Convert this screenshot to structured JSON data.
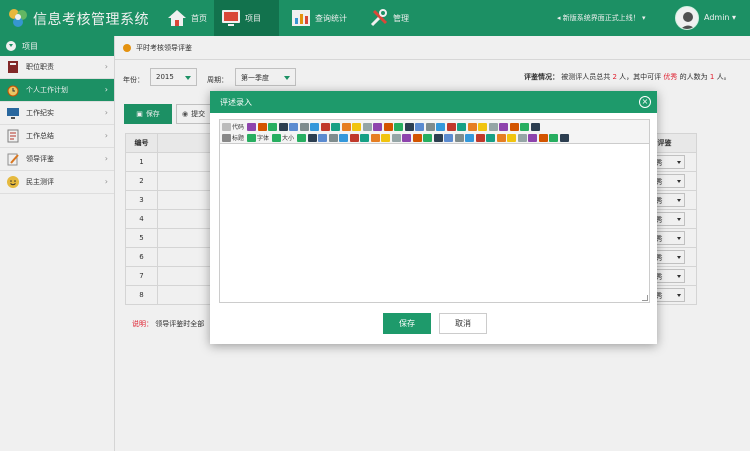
{
  "app": {
    "title": "信息考核管理系统"
  },
  "nav": {
    "home": "首页",
    "project": "项目",
    "stats": "查询统计",
    "manage": "管理"
  },
  "notice": "新版系统界面正式上线！",
  "user": {
    "name": "Admin"
  },
  "sidebar": {
    "header": "项目",
    "items": [
      {
        "label": "职位职责",
        "icon": "book-icon"
      },
      {
        "label": "个人工作计划",
        "icon": "alarm-clock-icon"
      },
      {
        "label": "工作纪实",
        "icon": "monitor-icon"
      },
      {
        "label": "工作总结",
        "icon": "document-icon"
      },
      {
        "label": "领导评鉴",
        "icon": "pen-paper-icon"
      },
      {
        "label": "民主测评",
        "icon": "smiley-icon"
      }
    ]
  },
  "page": {
    "breadcrumb": "平时考核领导评鉴",
    "year_label": "年份：",
    "year_value": "2015",
    "period_label": "周期：",
    "period_value": "第一季度",
    "summary_prefix": "评鉴情况：",
    "summary_text1": "被测评人员总共",
    "summary_total": "2",
    "summary_text2": "人，其中可评",
    "summary_excellent": "优秀",
    "summary_text3": "的人数为",
    "summary_count": "1",
    "summary_text4": "人。",
    "save_label": "保存",
    "submit_label": "提交",
    "note_label": "说明：",
    "note_text": "领导评鉴时全部"
  },
  "table": {
    "headers": {
      "index": "编号",
      "eval": "评鉴"
    },
    "rows": [
      {
        "index": "1",
        "eval": "优秀"
      },
      {
        "index": "2",
        "eval": "优秀"
      },
      {
        "index": "3",
        "eval": "优秀"
      },
      {
        "index": "4",
        "eval": "优秀"
      },
      {
        "index": "5",
        "eval": "优秀"
      },
      {
        "index": "6",
        "eval": "优秀"
      },
      {
        "index": "7",
        "eval": "优秀"
      },
      {
        "index": "8",
        "eval": "优秀"
      }
    ]
  },
  "modal": {
    "title": "评述录入",
    "editor": {
      "code_label": "代码",
      "heading_label": "标题",
      "font_label": "字体",
      "size_label": "大小"
    },
    "save_label": "保存",
    "cancel_label": "取消"
  },
  "colors": {
    "primary": "#1e9a6b",
    "primary_dark": "#147a52",
    "highlight": "#e23333"
  }
}
